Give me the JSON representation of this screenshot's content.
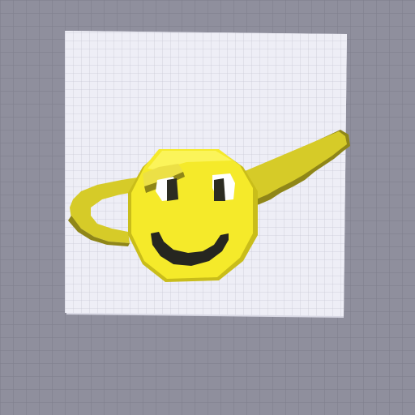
{
  "scene": {
    "name": "pixel-art-build-viewport",
    "colors": {
      "floor": "#8f8f9d",
      "floor_grid": "#7e7e8c",
      "board": "#eeeef6",
      "board_grid": "#c9c9d6",
      "board_shade": "#d8d8e4",
      "face": "#f5ea2a",
      "face_light": "#fbf45a",
      "face_shadow": "#c9bd1a",
      "cap": "#d6cb28",
      "cap_dark": "#8f8618",
      "cap_light": "#ece046",
      "eye_white": "#ffffff",
      "eye_dark": "#2c2c22",
      "mouth": "#262620"
    },
    "icons": [
      "smiley-face-icon",
      "cap-icon",
      "cap-brim-icon"
    ]
  }
}
